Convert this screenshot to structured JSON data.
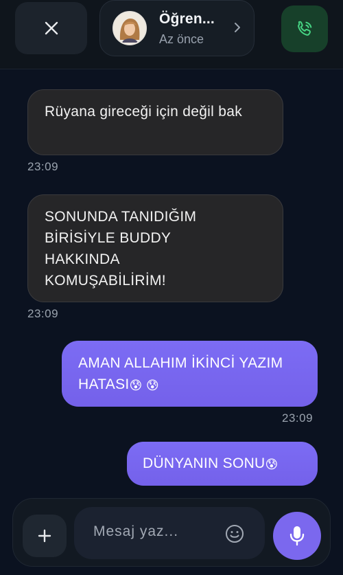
{
  "header": {
    "contact_name": "Öğren...",
    "contact_status": "Az önce",
    "icons": {
      "close": "close-icon",
      "chevron": "chevron-right-icon",
      "call": "phone-icon"
    },
    "call_color": "#17402a",
    "accent": "#7b68ee"
  },
  "messages": [
    {
      "direction": "in",
      "text": "Rüyana gireceği için değil bak",
      "time": "23:09"
    },
    {
      "direction": "in",
      "text": "SONUNDA TANIDIĞIM BİRİSİYLE BUDDY HAKKINDA KOMUŞABİLİRİM!",
      "time": "23:09"
    },
    {
      "direction": "out",
      "text": "AMAN ALLAHIM İKİNCİ YAZIM HATASI",
      "emoji": "😰 😰",
      "time": "23:09"
    },
    {
      "direction": "out",
      "text": "DÜNYANIN SONU",
      "emoji": "😰"
    }
  ],
  "composer": {
    "placeholder": "Mesaj yaz...",
    "value": "",
    "icons": {
      "add": "plus-icon",
      "emoji": "smile-icon",
      "mic": "microphone-icon"
    }
  }
}
